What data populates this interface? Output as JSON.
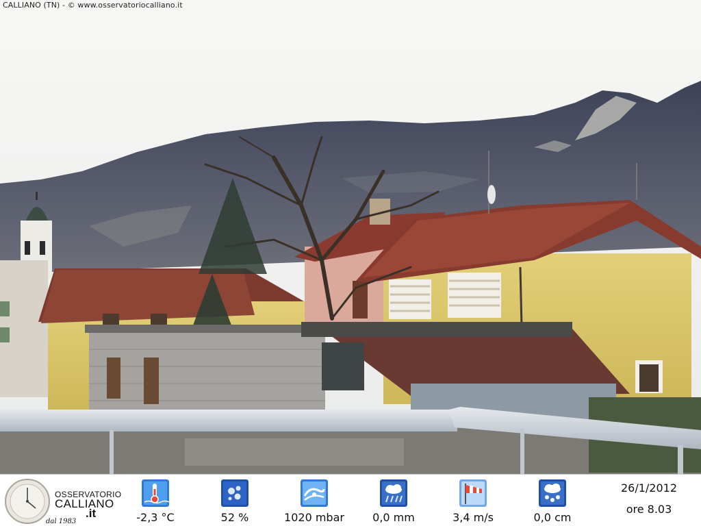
{
  "caption": "CALLIANO (TN) - © www.osservatoriocalliano.it",
  "logo": {
    "line1": "OSSERVATORIO",
    "line2": "CALLIANO",
    "line3": ".it",
    "line4": "dal 1983"
  },
  "readings": {
    "temperature": "-2,3 °C",
    "humidity": "52 %",
    "pressure": "1020 mbar",
    "rain": "0,0 mm",
    "wind": "3,4 m/s",
    "snow": "0,0 cm"
  },
  "datetime": {
    "date": "26/1/2012",
    "time": "ore 8.03"
  },
  "icons": {
    "temperature": "thermometer-icon",
    "humidity": "water-drops-icon",
    "pressure": "barometer-icon",
    "rain": "rain-cloud-icon",
    "wind": "windsock-icon",
    "snow": "snow-cloud-icon"
  },
  "colors": {
    "icon_blue": "#2a6fd6",
    "sky": "#f4f4f2",
    "mountain": "#4d4f62",
    "roof": "#8a3a2e",
    "wall_yellow": "#d9c46a"
  }
}
